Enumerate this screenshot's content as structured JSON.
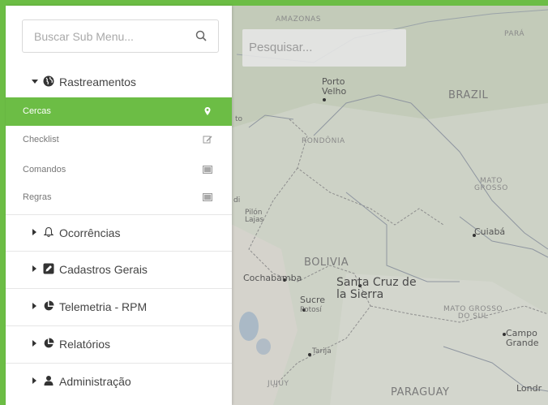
{
  "map": {
    "search_placeholder": "Pesquisar...",
    "labels": {
      "amazonas": "AMAZONAS",
      "para": "PARÁ",
      "brazil": "BRAZIL",
      "porto_velho": "Porto\nVelho",
      "rondonia": "RONDÔNIA",
      "mato_grosso": "MATO\nGROSSO",
      "cuiaba": "Cuiabá",
      "pilon_lajas": "Pilón\nLajas",
      "bolivia": "BOLIVIA",
      "cochabamba": "Cochabamba",
      "santa_cruz": "Santa Cruz de\nla Sierra",
      "sucre": "Sucre",
      "potosi": "Potosí",
      "mato_grosso_do_sul": "MATO GROSSO\nDO SUL",
      "campo_grande": "Campo\nGrande",
      "tarija": "Tarija",
      "jujuy": "JUJUY",
      "paraguay": "PARAGUAY",
      "londrina": "Londr",
      "edge_to": "to",
      "edge_di": "di"
    }
  },
  "sidebar": {
    "search_placeholder": "Buscar Sub Menu...",
    "groups": [
      {
        "label": "Rastreamentos",
        "icon": "globe-icon",
        "open": true
      },
      {
        "label": "Ocorrências",
        "icon": "bell-icon"
      },
      {
        "label": "Cadastros Gerais",
        "icon": "edit-icon"
      },
      {
        "label": "Telemetria - RPM",
        "icon": "pie-chart-icon"
      },
      {
        "label": "Relatórios",
        "icon": "pie-chart-icon"
      },
      {
        "label": "Administração",
        "icon": "user-icon"
      }
    ],
    "items": [
      {
        "label": "Cercas",
        "icon": "map-marker-icon",
        "active": true
      },
      {
        "label": "Checklist",
        "icon": "pencil-square-icon"
      },
      {
        "label": "Comandos",
        "icon": "list-icon"
      },
      {
        "label": "Regras",
        "icon": "list-icon"
      }
    ]
  },
  "colors": {
    "accent": "#6cbd45",
    "map_bg": "#cfd3c9",
    "sidebar_bg": "#ffffff"
  }
}
